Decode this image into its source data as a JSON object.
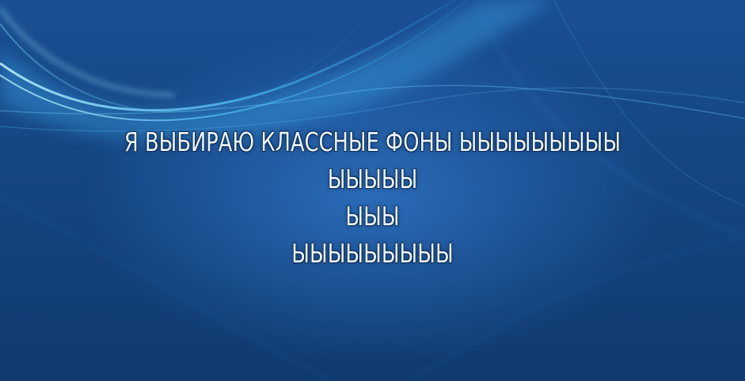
{
  "caption": {
    "lines": [
      "Я ВЫБИРАЮ КЛАССНЫЕ ФОНЫ ЫЫЫЫЫЫЫЫЫ",
      "ЫЫЫЫЫ",
      "ЫЫЫ",
      "ЫЫЫЫЫЫЫЫЫ"
    ]
  },
  "colors": {
    "background": "#154582",
    "wave_highlight": "#7fe0ff",
    "text": "#eaf4ff"
  }
}
